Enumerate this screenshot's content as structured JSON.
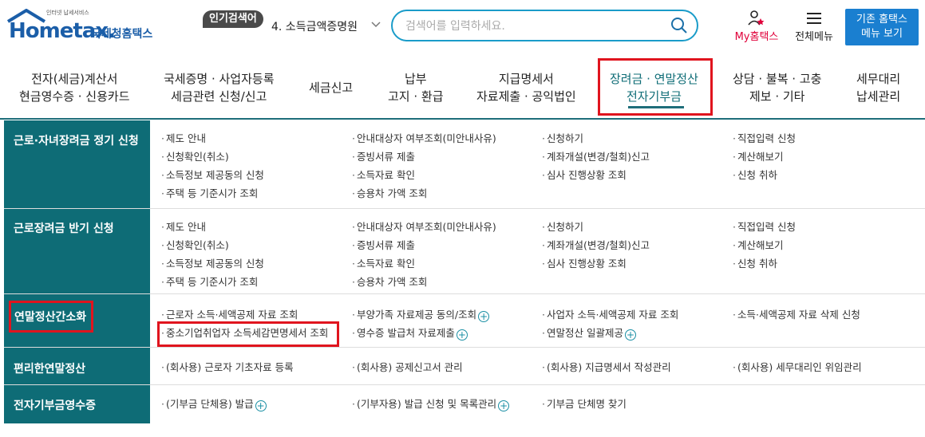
{
  "header": {
    "logo_tagline": "인터넷 납세서비스",
    "logo_word": "Hometax.",
    "logo_kr": "국세청홈택스",
    "popular_label": "인기검색어",
    "popular_item": "4. 소득금액증명원",
    "search_placeholder": "검색어를 입력하세요.",
    "my_label": "My홈택스",
    "allmenu_label": "전체메뉴",
    "old_menu_line1": "기존 홈택스",
    "old_menu_line2": "메뉴 보기"
  },
  "gnb": [
    {
      "l1": "전자(세금)계산서",
      "l2": "현금영수증 · 신용카드"
    },
    {
      "l1": "국세증명 · 사업자등록",
      "l2": "세금관련 신청/신고"
    },
    {
      "l1": "세금신고",
      "l2": ""
    },
    {
      "l1": "납부",
      "l2": "고지 · 환급"
    },
    {
      "l1": "지급명세서",
      "l2": "자료제출 · 공익법인"
    },
    {
      "l1": "장려금 · 연말정산",
      "l2": "전자기부금"
    },
    {
      "l1": "상담 · 불복 · 고충",
      "l2": "제보 · 기타"
    },
    {
      "l1": "세무대리",
      "l2": "납세관리"
    }
  ],
  "sections": [
    {
      "title": "근로·자녀장려금 정기 신청",
      "links": [
        "제도 안내",
        "안내대상자 여부조회(미안내사유)",
        "신청하기",
        "직접입력 신청",
        "신청확인(취소)",
        "증빙서류 제출",
        "계좌개설(변경/철회)신고",
        "계산해보기",
        "소득정보 제공동의 신청",
        "소득자료 확인",
        "심사 진행상황 조회",
        "신청 취하",
        "주택 등 기준시가 조회",
        "승용차 가액 조회"
      ]
    },
    {
      "title": "근로장려금 반기 신청",
      "links": [
        "제도 안내",
        "안내대상자 여부조회(미안내사유)",
        "신청하기",
        "직접입력 신청",
        "신청확인(취소)",
        "증빙서류 제출",
        "계좌개설(변경/철회)신고",
        "계산해보기",
        "소득정보 제공동의 신청",
        "소득자료 확인",
        "심사 진행상황 조회",
        "신청 취하",
        "주택 등 기준시가 조회",
        "승용차 가액 조회"
      ]
    },
    {
      "title": "연말정산간소화",
      "links": [
        "근로자 소득·세액공제 자료 조회",
        "부양가족 자료제공 동의/조회",
        "사업자 소득·세액공제 자료 조회",
        "소득·세액공제 자료 삭제 신청",
        "중소기업취업자 소득세감면명세서 조회",
        "영수증 발급처 자료제출",
        "연말정산 일괄제공"
      ]
    },
    {
      "title": "편리한연말정산",
      "links": [
        "(회사용) 근로자 기초자료 등록",
        "(회사용) 공제신고서 관리",
        "(회사용) 지급명세서 작성관리",
        "(회사용) 세무대리인 위임관리"
      ]
    },
    {
      "title": "전자기부금영수증",
      "links": [
        "(기부금 단체용) 발급",
        "(기부자용) 발급 신청 및 목록관리",
        "기부금 단체명 찾기"
      ]
    }
  ]
}
